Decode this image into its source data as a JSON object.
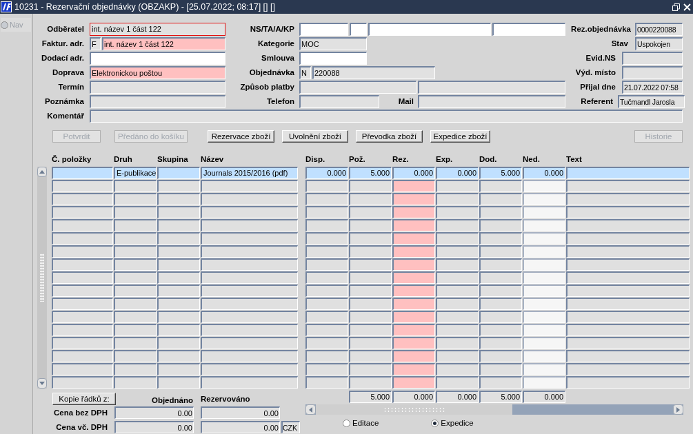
{
  "window": {
    "title": "10231 - Rezervační objednávky (OBZAKP) - [25.07.2022; 08:17] [] []"
  },
  "nav": {
    "label": "Nav",
    "selected": false,
    "disabled": true
  },
  "form_rows": [
    [
      {
        "label": "Odběratel",
        "fields": [
          {
            "kind": "display",
            "focused": true,
            "value": "int. název 1 část 122"
          }
        ]
      },
      {
        "label": "NS/TA/A/KP",
        "fields": [
          {
            "kind": "input",
            "focused": false
          },
          {
            "kind": "input",
            "focused": false
          },
          {
            "kind": "input",
            "focused": false
          },
          {
            "kind": "input",
            "focused": false
          }
        ]
      },
      {
        "label": "Rez.objednávka",
        "fields": [
          {
            "kind": "display",
            "focused": false,
            "value": "0000220088"
          }
        ]
      }
    ],
    [
      {
        "label": "Faktur. adr.",
        "fields": [
          {
            "kind": "display",
            "focused": false,
            "value": "F"
          },
          {
            "kind": "required",
            "focused": false,
            "value": "int. název 1 část 122"
          }
        ]
      },
      {
        "label": "Kategorie",
        "fields": [
          {
            "kind": "display",
            "focused": false,
            "value": "MOC"
          }
        ]
      },
      {
        "label": "Stav",
        "fields": [
          {
            "kind": "display",
            "focused": false,
            "value": "Uspokojen"
          }
        ]
      }
    ],
    [
      {
        "label": "Dodací adr.",
        "fields": [
          {
            "kind": "input",
            "focused": false
          }
        ]
      },
      {
        "label": "Smlouva",
        "fields": [
          {
            "kind": "input",
            "focused": false
          }
        ]
      },
      {
        "label": "Evid.NS",
        "fields": [
          {
            "kind": "display",
            "focused": false
          }
        ]
      }
    ],
    [
      {
        "label": "Doprava",
        "fields": [
          {
            "kind": "required",
            "focused": false,
            "value": "Elektronickou poštou"
          }
        ]
      },
      {
        "label": "Objednávka",
        "fields": [
          {
            "kind": "display",
            "focused": false,
            "value": "N"
          },
          {
            "kind": "display",
            "focused": false,
            "value": "220088"
          }
        ]
      },
      {
        "label": "Výd. místo",
        "fields": [
          {
            "kind": "display",
            "focused": false
          }
        ]
      }
    ],
    [
      {
        "label": "Termín",
        "fields": [
          {
            "kind": "display",
            "focused": false
          }
        ]
      },
      {
        "label": "Způsob platby",
        "fields": [
          {
            "kind": "display",
            "focused": false
          },
          {
            "kind": "display",
            "focused": false
          }
        ]
      },
      {
        "label": "Přijal dne",
        "fields": [
          {
            "kind": "display",
            "focused": false,
            "value": "21.07.2022 07:58"
          }
        ]
      }
    ],
    [
      {
        "label": "Poznámka",
        "fields": [
          {
            "kind": "display",
            "focused": false
          }
        ]
      },
      {
        "label": "Telefon",
        "fields": [
          {
            "kind": "display",
            "focused": false
          }
        ]
      },
      {
        "label": "Mail",
        "fields": [
          {
            "kind": "display",
            "focused": false
          }
        ]
      },
      {
        "label": "Referent",
        "fields": [
          {
            "kind": "display",
            "focused": false,
            "value": "Tučmandl Jarosla"
          }
        ]
      }
    ],
    [
      {
        "label": "Komentář",
        "fields": [
          {
            "kind": "display",
            "focused": false
          }
        ]
      }
    ]
  ],
  "buttons": [
    {
      "label": "Potvrdit",
      "disabled": true
    },
    {
      "label": "Předáno do košíku",
      "disabled": true
    },
    {
      "label": "Rezervace zboží",
      "disabled": false
    },
    {
      "label": "Uvolnění zboží",
      "disabled": false
    },
    {
      "label": "Převodka zboží",
      "disabled": false
    },
    {
      "label": "Expedice zboží",
      "disabled": false
    },
    {
      "label": "Historie",
      "disabled": true
    }
  ],
  "table": {
    "columns": [
      {
        "label": "Č. položky",
        "kind": "text",
        "required": false,
        "disabled": false
      },
      {
        "label": "Druh",
        "kind": "text",
        "required": false,
        "disabled": false
      },
      {
        "label": "Skupina",
        "kind": "text",
        "required": false,
        "disabled": false
      },
      {
        "label": "Název",
        "kind": "text",
        "required": false,
        "disabled": false
      },
      {
        "label": "Disp.",
        "kind": "number",
        "required": false,
        "disabled": false
      },
      {
        "label": "Pož.",
        "kind": "number",
        "required": false,
        "disabled": false
      },
      {
        "label": "Rez.",
        "kind": "number",
        "required": true,
        "disabled": false
      },
      {
        "label": "Exp.",
        "kind": "number",
        "required": false,
        "disabled": false
      },
      {
        "label": "Dod.",
        "kind": "number",
        "required": false,
        "disabled": false
      },
      {
        "label": "Ned.",
        "kind": "number",
        "required": false,
        "disabled": true
      },
      {
        "label": "Text",
        "kind": "text",
        "required": false,
        "disabled": false
      }
    ],
    "rows": [
      {
        "selected": true,
        "cells": [
          null,
          "E-publikace",
          null,
          "Journals 2015/2016 (pdf)",
          "0.000",
          "5.000",
          "0.000",
          "0.000",
          "5.000",
          "0.000",
          null
        ]
      },
      {
        "selected": false
      },
      {
        "selected": false
      },
      {
        "selected": false
      },
      {
        "selected": false
      },
      {
        "selected": false
      },
      {
        "selected": false
      },
      {
        "selected": false
      },
      {
        "selected": false
      },
      {
        "selected": false
      },
      {
        "selected": false
      },
      {
        "selected": false
      },
      {
        "selected": false
      },
      {
        "selected": false
      },
      {
        "selected": false
      },
      {
        "selected": false
      },
      {
        "selected": false
      }
    ],
    "totals": [
      "5.000",
      "0.000",
      "0.000",
      "5.000",
      "0.000"
    ]
  },
  "copy_button": {
    "label": "Kopie řádků z:"
  },
  "price_headings": [
    "Objednáno",
    "Rezervováno"
  ],
  "price_rows": [
    {
      "label": "Cena bez DPH",
      "ordered": "0.00",
      "reserved": "0.00"
    },
    {
      "label": "Cena vč. DPH",
      "ordered": "0.00",
      "reserved": "0.00",
      "currency": "CZK"
    }
  ],
  "mode_options": [
    {
      "label": "Editace",
      "selected": false
    },
    {
      "label": "Expedice",
      "selected": true
    }
  ]
}
